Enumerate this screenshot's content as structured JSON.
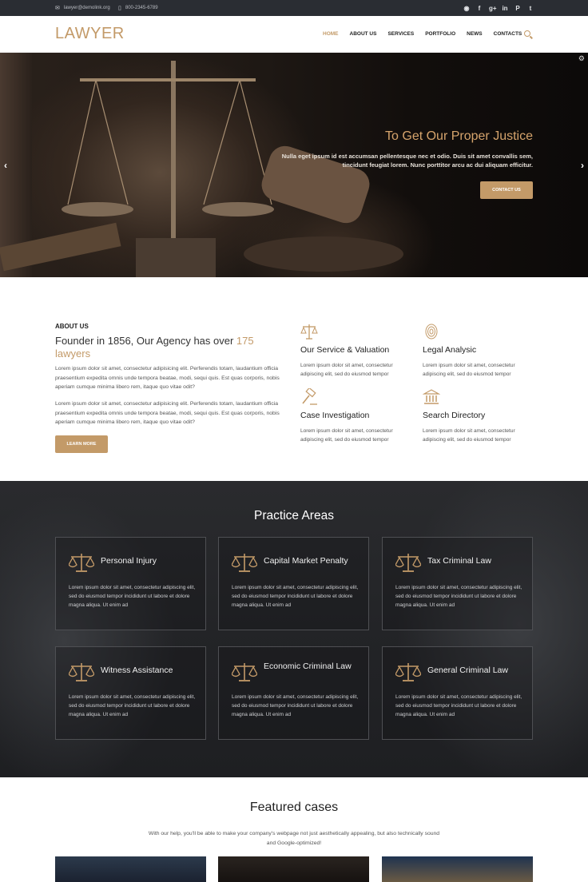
{
  "topbar": {
    "email": "lawyer@demolink.org",
    "phone": "800-2345-6789",
    "socials": [
      "rss-icon",
      "facebook-icon",
      "google-plus-icon",
      "linkedin-icon",
      "pinterest-icon",
      "twitter-icon"
    ]
  },
  "header": {
    "logo": "LAWYER",
    "nav": [
      "HOME",
      "ABOUT US",
      "SERVICES",
      "PORTFOLIO",
      "NEWS",
      "CONTACTS"
    ],
    "active_nav": "HOME"
  },
  "hero": {
    "title": "To Get Our Proper Justice",
    "text": "Nulla eget ipsum id est accumsan pellentesque nec et odio. Duis sit amet convallis sem, tincidunt feugiat lorem. Nunc porttitor arcu ac dui aliquam efficitur.",
    "button": "CONTACT US"
  },
  "about": {
    "label": "ABOUT US",
    "title_prefix": "Founder in 1856, Our Agency has over ",
    "title_highlight": "175 lawyers",
    "paragraph1": "Lorem ipsum dolor sit amet, consectetur adipisicing elit. Perferendis totam, laudantium officia praesentium expedita omnis unde tempora beatae, modi, sequi quis. Est quas corporis, nobis aperiam cumque minima libero rem, itaque quo vitae odit?",
    "paragraph2": "Lorem ipsum dolor sit amet, consectetur adipisicing elit. Perferendis totam, laudantium officia praesentium expedita omnis unde tempora beatae, modi, sequi quis. Est quas corporis, nobis aperiam cumque minima libero rem, itaque quo vitae odit?",
    "button": "LEARN MORE",
    "features": [
      {
        "title": "Our Service & Valuation",
        "text": "Lorem ipsum dolor sit amet, consectetur adipiscing elit, sed do eiusmod tempor",
        "icon": "scales-icon"
      },
      {
        "title": "Legal Analysic",
        "text": "Lorem ipsum dolor sit amet, consectetur adipiscing elit, sed do eiusmod tempor",
        "icon": "fingerprint-icon"
      },
      {
        "title": "Case Investigation",
        "text": "Lorem ipsum dolor sit amet, consectetur adipiscing elit, sed do eiusmod tempor",
        "icon": "gavel-icon"
      },
      {
        "title": "Search Directory",
        "text": "Lorem ipsum dolor sit amet, consectetur adipiscing elit, sed do eiusmod tempor",
        "icon": "courthouse-icon"
      }
    ]
  },
  "practice": {
    "title": "Practice Areas",
    "cards": [
      {
        "title": "Personal Injury",
        "text": "Lorem ipsum dolor sit amet, consectetur adipiscing elit, sed do eiusmod tempor incididunt ut labore et dolore magna aliqua. Ut enim ad"
      },
      {
        "title": "Capital Market Penalty",
        "text": "Lorem ipsum dolor sit amet, consectetur adipiscing elit, sed do eiusmod tempor incididunt ut labore et dolore magna aliqua. Ut enim ad"
      },
      {
        "title": "Tax Criminal Law",
        "text": "Lorem ipsum dolor sit amet, consectetur adipiscing elit, sed do eiusmod tempor incididunt ut labore et dolore magna aliqua. Ut enim ad"
      },
      {
        "title": "Witness Assistance",
        "text": "Lorem ipsum dolor sit amet, consectetur adipiscing elit, sed do eiusmod tempor incididunt ut labore et dolore magna aliqua. Ut enim ad"
      },
      {
        "title": "Economic Criminal Law",
        "text": "Lorem ipsum dolor sit amet, consectetur adipiscing elit, sed do eiusmod tempor incididunt ut labore et dolore magna aliqua. Ut enim ad"
      },
      {
        "title": "General Criminal Law",
        "text": "Lorem ipsum dolor sit amet, consectetur adipiscing elit, sed do eiusmod tempor incididunt ut labore et dolore magna aliqua. Ut enim ad"
      }
    ]
  },
  "featured": {
    "title": "Featured cases",
    "text": "With our help, you'll be able to make your company's webpage not just aesthetically appealing, but also technically sound and Google-optimized!"
  },
  "colors": {
    "accent": "#c39a68",
    "topbar": "#2a2d33",
    "dark_section": "#232427"
  }
}
